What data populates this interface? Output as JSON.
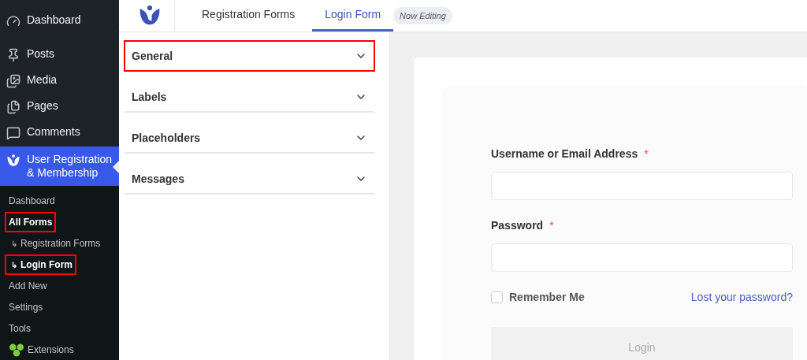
{
  "sidebar": {
    "menu": [
      {
        "label": "Dashboard",
        "selected": false
      },
      {
        "label": "Posts",
        "selected": false
      },
      {
        "label": "Media",
        "selected": false
      },
      {
        "label": "Pages",
        "selected": false
      },
      {
        "label": "Comments",
        "selected": false
      },
      {
        "label": "User Registration & Membership",
        "selected": true
      }
    ],
    "submenu": [
      {
        "label": "Dashboard",
        "kind": "plain",
        "current": false,
        "highlighted": false
      },
      {
        "label": "All Forms",
        "kind": "plain",
        "current": true,
        "highlighted": true
      },
      {
        "label": "Registration Forms",
        "arrow": "↳",
        "kind": "sub",
        "current": false,
        "highlighted": false
      },
      {
        "label": "Login Form",
        "arrow": "↳",
        "kind": "sub",
        "current": true,
        "highlighted": true
      },
      {
        "label": "Add New",
        "kind": "plain",
        "current": false,
        "highlighted": false
      },
      {
        "label": "Settings",
        "kind": "plain",
        "current": false,
        "highlighted": false
      },
      {
        "label": "Tools",
        "kind": "plain",
        "current": false,
        "highlighted": false
      },
      {
        "label": "Extensions",
        "kind": "extensions",
        "current": false,
        "highlighted": false
      }
    ]
  },
  "tabs": [
    {
      "label": "Registration Forms",
      "selected": false
    },
    {
      "label": "Login Form",
      "selected": true,
      "badge": "Now Editing"
    }
  ],
  "sections": [
    {
      "label": "General",
      "highlighted": true,
      "expanded": false
    },
    {
      "label": "Labels",
      "highlighted": false,
      "expanded": false
    },
    {
      "label": "Placeholders",
      "highlighted": false,
      "expanded": false
    },
    {
      "label": "Messages",
      "highlighted": false,
      "expanded": false
    }
  ],
  "form": {
    "fields": [
      {
        "label": "Username or Email Address",
        "required": "*"
      },
      {
        "label": "Password",
        "required": "*"
      }
    ],
    "remember": {
      "label": "Remember Me",
      "checked": false
    },
    "lost_link": "Lost your password?",
    "submit": "Login"
  }
}
